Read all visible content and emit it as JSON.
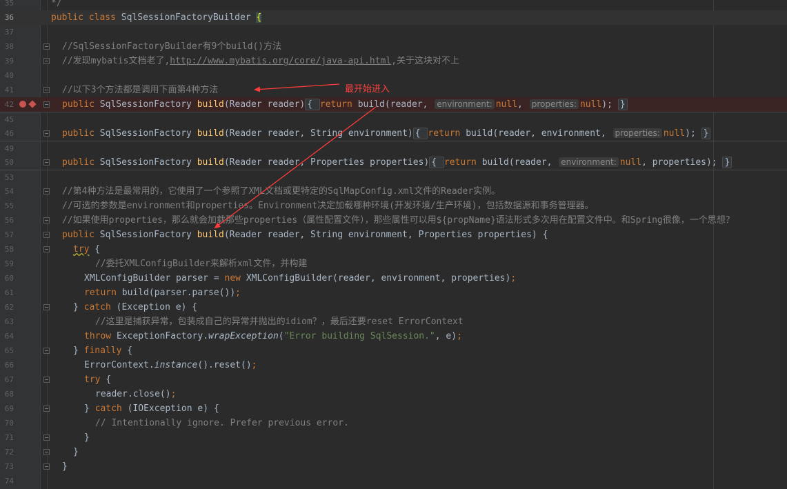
{
  "editor": {
    "lines": [
      {
        "n": "35",
        "ind": 0,
        "fold": false,
        "tokens": [
          {
            "t": "*/",
            "c": "cm"
          }
        ]
      },
      {
        "n": "36",
        "ind": 0,
        "current": true,
        "tokens": [
          {
            "t": "public ",
            "c": "kw"
          },
          {
            "t": "class ",
            "c": "kw"
          },
          {
            "t": "SqlSessionFactoryBuilder "
          },
          {
            "t": "{",
            "c": "match"
          }
        ]
      },
      {
        "n": "37",
        "ind": 0,
        "tokens": []
      },
      {
        "n": "38",
        "ind": 1,
        "fold": true,
        "tokens": [
          {
            "t": "//SqlSessionFactoryBuilder有9个build()方法",
            "c": "cm"
          }
        ]
      },
      {
        "n": "39",
        "ind": 1,
        "fold": true,
        "tokens": [
          {
            "t": "//发现mybatis文档老了,",
            "c": "cm"
          },
          {
            "t": "http://www.mybatis.org/core/java-api.html",
            "c": "link"
          },
          {
            "t": ",关于这块对不上",
            "c": "cm"
          }
        ]
      },
      {
        "n": "40",
        "ind": 0,
        "tokens": []
      },
      {
        "n": "41",
        "ind": 1,
        "fold": true,
        "tokens": [
          {
            "t": "//以下3个方法都是调用下面第4种方法",
            "c": "cm"
          }
        ]
      },
      {
        "n": "42",
        "ind": 1,
        "fold": true,
        "bp": true,
        "tokens": [
          {
            "t": "public ",
            "c": "kw"
          },
          {
            "t": "SqlSessionFactory "
          },
          {
            "t": "build",
            "c": "fn"
          },
          {
            "t": "(Reader reader)"
          },
          {
            "t": "{ ",
            "c": "bf"
          },
          {
            "t": "return ",
            "c": "kw"
          },
          {
            "t": "build(reader, "
          },
          {
            "t": "environment:",
            "c": "hint"
          },
          {
            "t": "null",
            "c": "kw"
          },
          {
            "t": ", "
          },
          {
            "t": "properties:",
            "c": "hint"
          },
          {
            "t": "null",
            "c": "kw"
          },
          {
            "t": "); "
          },
          {
            "t": "}",
            "c": "bf"
          }
        ]
      },
      {
        "n": "45",
        "ind": 0,
        "sep": true,
        "tokens": []
      },
      {
        "n": "46",
        "ind": 1,
        "fold": true,
        "tokens": [
          {
            "t": "public ",
            "c": "kw"
          },
          {
            "t": "SqlSessionFactory "
          },
          {
            "t": "build",
            "c": "fn"
          },
          {
            "t": "(Reader reader, String environment)"
          },
          {
            "t": "{ ",
            "c": "bf"
          },
          {
            "t": "return ",
            "c": "kw"
          },
          {
            "t": "build(reader, environment, "
          },
          {
            "t": "properties:",
            "c": "hint"
          },
          {
            "t": "null",
            "c": "kw"
          },
          {
            "t": "); "
          },
          {
            "t": "}",
            "c": "bf"
          }
        ]
      },
      {
        "n": "49",
        "ind": 0,
        "sep": true,
        "tokens": []
      },
      {
        "n": "50",
        "ind": 1,
        "fold": true,
        "tokens": [
          {
            "t": "public ",
            "c": "kw"
          },
          {
            "t": "SqlSessionFactory "
          },
          {
            "t": "build",
            "c": "fn"
          },
          {
            "t": "(Reader reader, Properties properties)"
          },
          {
            "t": "{ ",
            "c": "bf"
          },
          {
            "t": "return ",
            "c": "kw"
          },
          {
            "t": "build(reader, "
          },
          {
            "t": "environment:",
            "c": "hint"
          },
          {
            "t": "null",
            "c": "kw"
          },
          {
            "t": ", properties); "
          },
          {
            "t": "}",
            "c": "bf"
          }
        ]
      },
      {
        "n": "53",
        "ind": 0,
        "sep": true,
        "tokens": []
      },
      {
        "n": "54",
        "ind": 1,
        "fold": true,
        "tokens": [
          {
            "t": "//第4种方法是最常用的，它使用了一个参照了XML文档或更特定的SqlMapConfig.xml文件的Reader实例。",
            "c": "cm"
          }
        ]
      },
      {
        "n": "55",
        "ind": 1,
        "tokens": [
          {
            "t": "//可选的参数是environment和properties。Environment决定加载哪种环境(开发环境/生产环境)，包括数据源和事务管理器。",
            "c": "cm"
          }
        ]
      },
      {
        "n": "56",
        "ind": 1,
        "fold": true,
        "tokens": [
          {
            "t": "//如果使用properties，那么就会加载那些properties（属性配置文件），那些属性可以用${propName}语法形式多次用在配置文件中。和Spring很像，一个思想？",
            "c": "cm"
          }
        ]
      },
      {
        "n": "57",
        "ind": 1,
        "fold": true,
        "tokens": [
          {
            "t": "public ",
            "c": "kw"
          },
          {
            "t": "SqlSessionFactory "
          },
          {
            "t": "build",
            "c": "fn"
          },
          {
            "t": "(Reader reader, String environment, Properties properties) {"
          }
        ]
      },
      {
        "n": "58",
        "ind": 2,
        "fold": true,
        "tokens": [
          {
            "t": "try",
            "c": "kw warn"
          },
          {
            "t": " {"
          }
        ]
      },
      {
        "n": "59",
        "ind": 4,
        "tokens": [
          {
            "t": "//委托XMLConfigBuilder来解析xml文件，并构建",
            "c": "cm"
          }
        ]
      },
      {
        "n": "60",
        "ind": 3,
        "tokens": [
          {
            "t": "XMLConfigBuilder parser = "
          },
          {
            "t": "new ",
            "c": "kw"
          },
          {
            "t": "XMLConfigBuilder(reader, environment, properties)"
          },
          {
            "t": ";",
            "c": "kw"
          }
        ]
      },
      {
        "n": "61",
        "ind": 3,
        "tokens": [
          {
            "t": "return ",
            "c": "kw"
          },
          {
            "t": "build(parser.parse())"
          },
          {
            "t": ";",
            "c": "kw"
          }
        ]
      },
      {
        "n": "62",
        "ind": 2,
        "fold": true,
        "tokens": [
          {
            "t": "} "
          },
          {
            "t": "catch ",
            "c": "kw"
          },
          {
            "t": "(Exception e) {"
          }
        ]
      },
      {
        "n": "63",
        "ind": 4,
        "tokens": [
          {
            "t": "//这里是捕获异常，包装成自己的异常并抛出的idiom？，最后还要reset ErrorContext",
            "c": "cm"
          }
        ]
      },
      {
        "n": "64",
        "ind": 3,
        "tokens": [
          {
            "t": "throw ",
            "c": "kw"
          },
          {
            "t": "ExceptionFactory."
          },
          {
            "t": "wrapException",
            "c": "ital"
          },
          {
            "t": "("
          },
          {
            "t": "\"Error building SqlSession.\"",
            "c": "str"
          },
          {
            "t": ", e)"
          },
          {
            "t": ";",
            "c": "kw"
          }
        ]
      },
      {
        "n": "65",
        "ind": 2,
        "fold": true,
        "tokens": [
          {
            "t": "} "
          },
          {
            "t": "finally ",
            "c": "kw"
          },
          {
            "t": "{"
          }
        ]
      },
      {
        "n": "66",
        "ind": 3,
        "tokens": [
          {
            "t": "ErrorContext."
          },
          {
            "t": "instance",
            "c": "ital"
          },
          {
            "t": "().reset()"
          },
          {
            "t": ";",
            "c": "kw"
          }
        ]
      },
      {
        "n": "67",
        "ind": 3,
        "fold": true,
        "tokens": [
          {
            "t": "try ",
            "c": "kw"
          },
          {
            "t": "{"
          }
        ]
      },
      {
        "n": "68",
        "ind": 4,
        "tokens": [
          {
            "t": "reader.close()"
          },
          {
            "t": ";",
            "c": "kw"
          }
        ]
      },
      {
        "n": "69",
        "ind": 3,
        "fold": true,
        "tokens": [
          {
            "t": "} "
          },
          {
            "t": "catch ",
            "c": "kw"
          },
          {
            "t": "(IOException e) {"
          }
        ]
      },
      {
        "n": "70",
        "ind": 4,
        "tokens": [
          {
            "t": "// Intentionally ignore. Prefer previous error.",
            "c": "cm"
          }
        ]
      },
      {
        "n": "71",
        "ind": 3,
        "fold": true,
        "tokens": [
          {
            "t": "}"
          }
        ]
      },
      {
        "n": "72",
        "ind": 2,
        "fold": true,
        "tokens": [
          {
            "t": "}"
          }
        ]
      },
      {
        "n": "73",
        "ind": 1,
        "fold": true,
        "tokens": [
          {
            "t": "}"
          }
        ]
      },
      {
        "n": "74",
        "ind": 0,
        "tokens": []
      }
    ]
  },
  "annotation": {
    "label": "最开始进入",
    "color": "#ff3b3b"
  },
  "colors": {
    "background": "#2b2b2b",
    "keyword": "#cc7832",
    "method": "#ffc66d",
    "comment": "#808080",
    "string": "#6a8759",
    "breakpoint": "#c75450"
  }
}
